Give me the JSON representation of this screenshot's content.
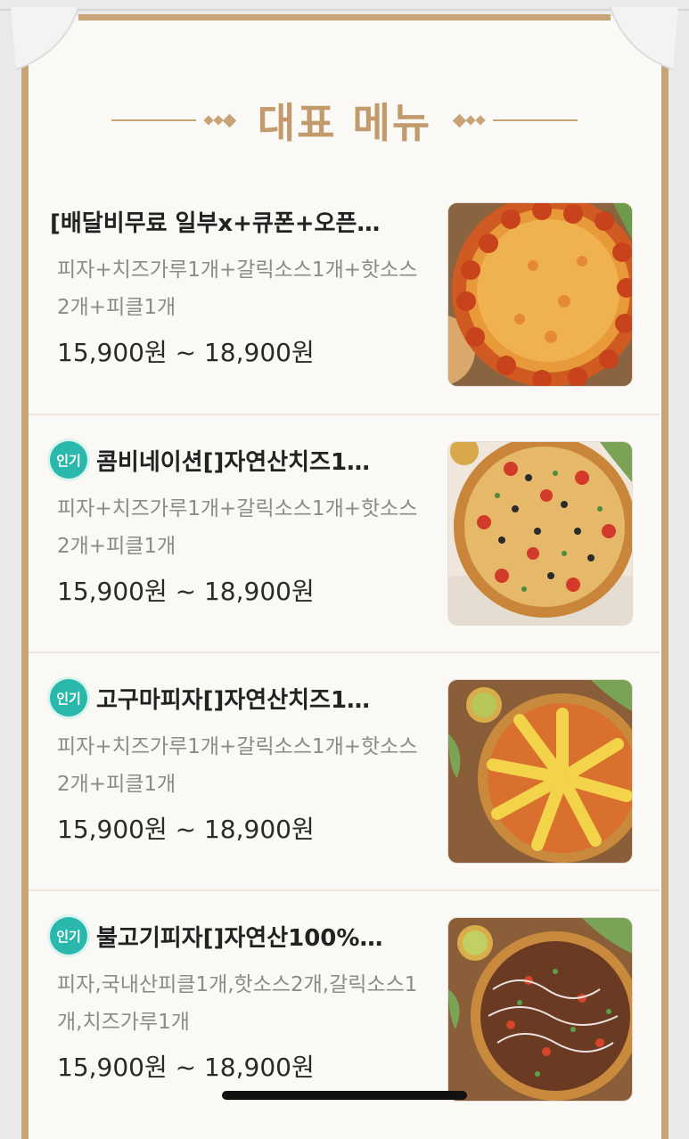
{
  "section": {
    "title": "대표 메뉴"
  },
  "menu_items": [
    {
      "badge": "",
      "name": "[배달비무료 일부x+큐폰+오픈…",
      "description": "피자+치즈가루1개+갈릭소스1개+핫소스2개+피클1개",
      "price": "15,900원 ~ 18,900원",
      "image": "pepperoni-pizza"
    },
    {
      "badge": "인기",
      "name": "콤비네이션[]자연산치즈1…",
      "description": "피자+치즈가루1개+갈릭소스1개+핫소스2개+피클1개",
      "price": "15,900원 ~ 18,900원",
      "image": "combination-pizza"
    },
    {
      "badge": "인기",
      "name": "고구마피자[]자연산치즈1…",
      "description": "피자+치즈가루1개+갈릭소스1개+핫소스2개+피클1개",
      "price": "15,900원 ~ 18,900원",
      "image": "sweet-potato-pizza"
    },
    {
      "badge": "인기",
      "name": "불고기피자[]자연산100%…",
      "description": "피자,국내산피클1개,핫소스2개,갈릭소스1개,치즈가루1개",
      "price": "15,900원 ~ 18,900원",
      "image": "bulgogi-pizza"
    }
  ],
  "colors": {
    "accent": "#c8a377",
    "title": "#c29a6b",
    "badge": "#2bb8ac"
  }
}
